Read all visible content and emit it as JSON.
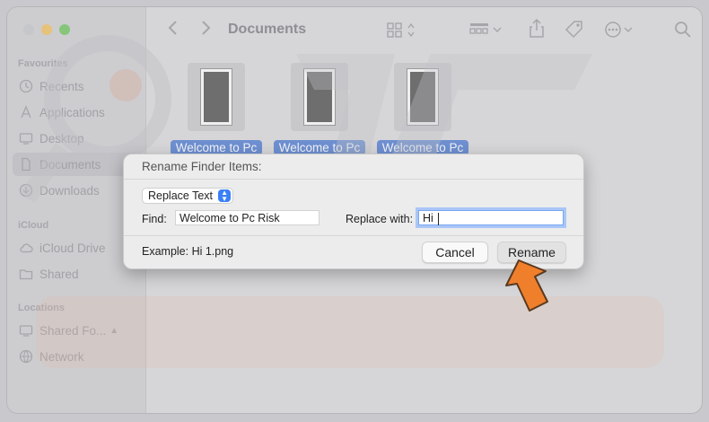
{
  "window": {
    "title": "Documents"
  },
  "sidebar": {
    "sections": [
      {
        "label": "Favourites",
        "items": [
          {
            "label": "Recents",
            "icon": "clock-icon"
          },
          {
            "label": "Applications",
            "icon": "applications-icon"
          },
          {
            "label": "Desktop",
            "icon": "desktop-icon"
          },
          {
            "label": "Documents",
            "icon": "document-icon",
            "selected": true
          },
          {
            "label": "Downloads",
            "icon": "download-icon"
          }
        ]
      },
      {
        "label": "iCloud",
        "items": [
          {
            "label": "iCloud Drive",
            "icon": "cloud-icon"
          },
          {
            "label": "Shared",
            "icon": "shared-folder-icon"
          }
        ]
      },
      {
        "label": "Locations",
        "items": [
          {
            "label": "Shared Fo...",
            "icon": "monitor-icon"
          },
          {
            "label": "Network",
            "icon": "network-icon"
          }
        ]
      }
    ]
  },
  "files": [
    {
      "label": "Welcome to Pc"
    },
    {
      "label": "Welcome to Pc"
    },
    {
      "label": "Welcome to Pc"
    }
  ],
  "dialog": {
    "title": "Rename Finder Items:",
    "mode": "Replace Text",
    "find_label": "Find:",
    "find_value": "Welcome to Pc Risk",
    "replace_label": "Replace with:",
    "replace_value": "Hi",
    "example": "Example: Hi 1.png",
    "cancel_label": "Cancel",
    "rename_label": "Rename"
  },
  "colors": {
    "selection": "#6e8fd0",
    "accent": "#3a80f7",
    "arrow": "#f07f2c"
  }
}
